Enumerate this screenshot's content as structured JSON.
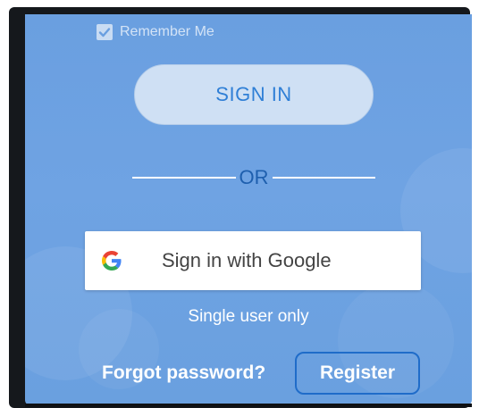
{
  "remember": {
    "label": "Remember Me",
    "checked": true,
    "icon": "checkmark-icon"
  },
  "signin": {
    "label": "SIGN IN"
  },
  "divider": {
    "label": "OR"
  },
  "google": {
    "label": "Sign in with Google",
    "icon": "google-g-icon"
  },
  "note": {
    "text": "Single user only"
  },
  "footer": {
    "forgot_label": "Forgot password?",
    "register_label": "Register"
  },
  "colors": {
    "background": "#6a9fe0",
    "signin_bg": "#cfe0f4",
    "signin_text": "#2f7fd6",
    "or_text": "#1e5fae",
    "register_border": "#1f6cc9"
  }
}
